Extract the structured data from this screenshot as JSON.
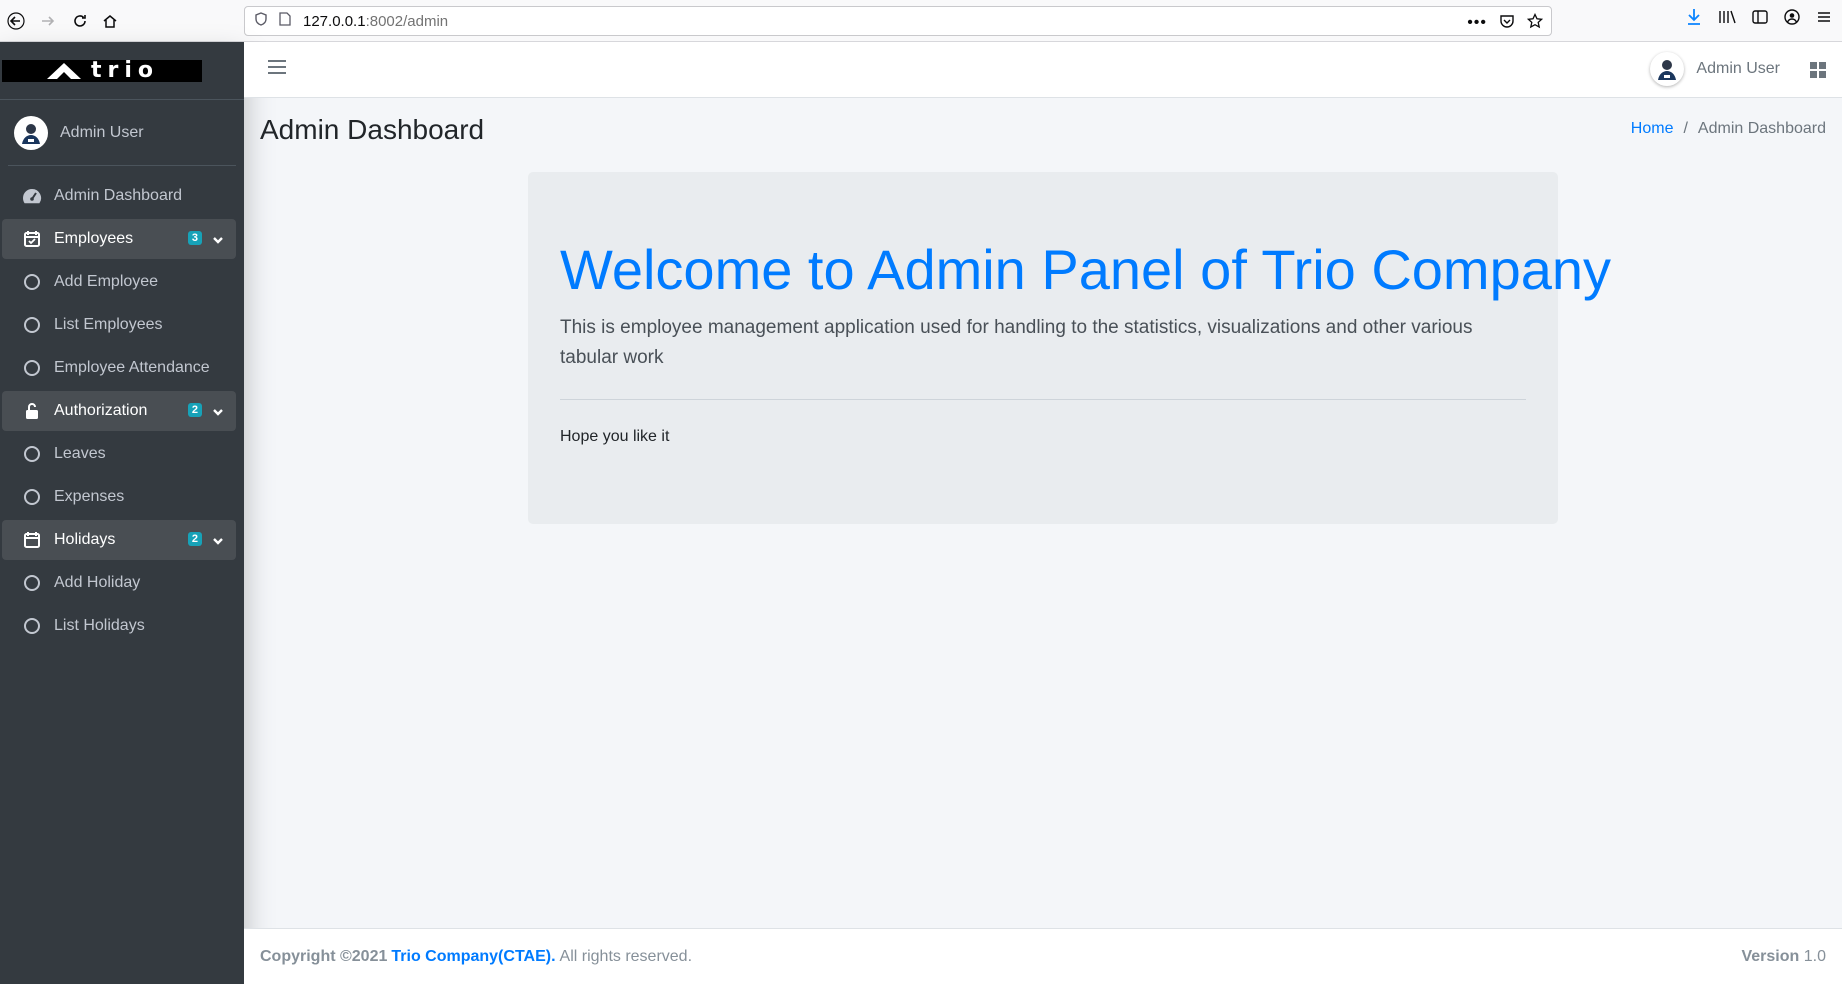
{
  "browser": {
    "url_host": "127.0.0.1",
    "url_rest": ":8002/admin"
  },
  "brand": {
    "logo_text": "trio"
  },
  "sidebar": {
    "user_name": "Admin User",
    "items": [
      {
        "label": "Admin Dashboard",
        "icon": "tachometer-icon"
      },
      {
        "label": "Employees",
        "icon": "calendar-check-icon",
        "badge": "3"
      },
      {
        "label": "Add Employee",
        "icon": "circle-icon"
      },
      {
        "label": "List Employees",
        "icon": "circle-icon"
      },
      {
        "label": "Employee Attendance",
        "icon": "circle-icon"
      },
      {
        "label": "Authorization",
        "icon": "unlock-icon",
        "badge": "2"
      },
      {
        "label": "Leaves",
        "icon": "circle-icon"
      },
      {
        "label": "Expenses",
        "icon": "circle-icon"
      },
      {
        "label": "Holidays",
        "icon": "calendar-icon",
        "badge": "2"
      },
      {
        "label": "Add Holiday",
        "icon": "circle-icon"
      },
      {
        "label": "List Holidays",
        "icon": "circle-icon"
      }
    ]
  },
  "header": {
    "user_name": "Admin User"
  },
  "page": {
    "title": "Admin Dashboard",
    "breadcrumb_home": "Home",
    "breadcrumb_sep": "/",
    "breadcrumb_current": "Admin Dashboard"
  },
  "jumbotron": {
    "title": "Welcome to Admin Panel of Trio Company",
    "lead": "This is employee management application used for handling to the statistics, visualizations and other various tabular work",
    "text": "Hope you like it"
  },
  "footer": {
    "copyright": "Copyright ©2021",
    "company": "Trio Company(CTAE).",
    "rights": "All rights reserved.",
    "version_label": "Version",
    "version_value": "1.0"
  },
  "colors": {
    "accent": "#007bff",
    "sidebar_bg": "#343a40",
    "badge": "#17a2b8"
  }
}
